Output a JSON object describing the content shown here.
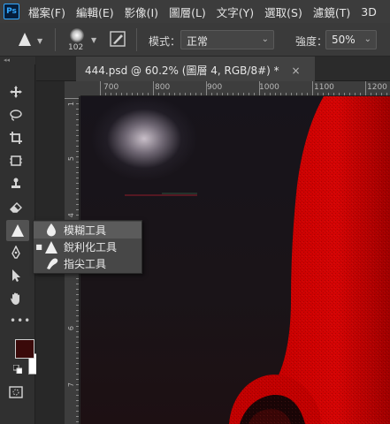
{
  "app": {
    "logo": "Ps"
  },
  "menubar": {
    "items": [
      "檔案(F)",
      "編輯(E)",
      "影像(I)",
      "圖層(L)",
      "文字(Y)",
      "選取(S)",
      "濾鏡(T)",
      "3D"
    ]
  },
  "options": {
    "tool_icon": "blur-triangle-icon",
    "brush_size": "102",
    "mode_label": "模式：",
    "mode_value": "正常",
    "strength_label": "強度：",
    "strength_value": "50%"
  },
  "document": {
    "tab_title": "444.psd @ 60.2% (圖層 4, RGB/8#) *",
    "close_glyph": "×"
  },
  "rulers": {
    "top_labels": [
      "700",
      "800",
      "900",
      "1000",
      "1100",
      "1200"
    ],
    "left_labels": [
      "1",
      "5",
      "4",
      "5",
      "6",
      "7"
    ]
  },
  "flyout": {
    "items": [
      {
        "label": "模糊工具",
        "icon": "drop-icon",
        "selected": false,
        "highlighted": true
      },
      {
        "label": "銳利化工具",
        "icon": "triangle-icon",
        "selected": true,
        "highlighted": false
      },
      {
        "label": "指尖工具",
        "icon": "finger-icon",
        "selected": false,
        "highlighted": false
      }
    ]
  },
  "colors": {
    "foreground": "#3a0a0a",
    "background": "#ffffff",
    "canvas_red": "#c80000"
  },
  "toolbar": {
    "more_glyph": "•••",
    "swap_glyph": "⇆"
  }
}
